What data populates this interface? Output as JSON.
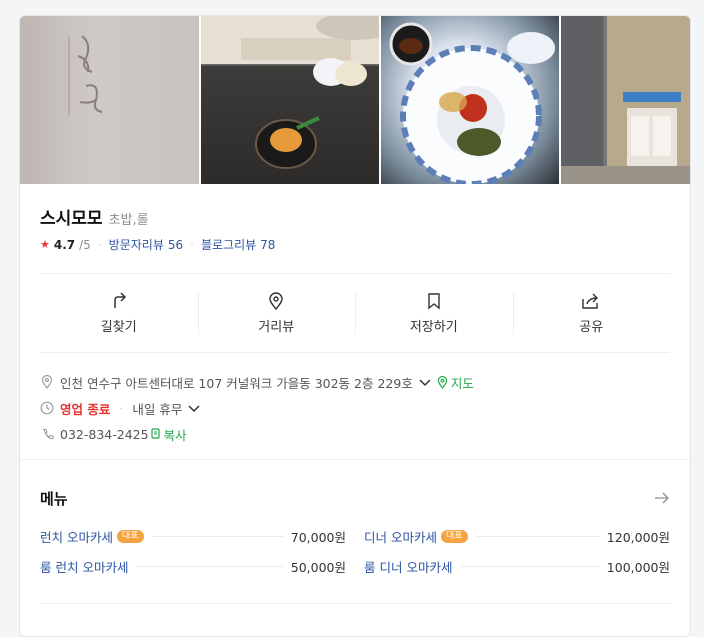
{
  "place": {
    "name": "스시모모",
    "category": "초밥,롤",
    "rating": "4.7",
    "rating_max": "/5",
    "visitor_reviews_label": "방문자리뷰",
    "visitor_reviews_count": "56",
    "blog_reviews_label": "블로그리뷰",
    "blog_reviews_count": "78"
  },
  "photos": [
    {
      "alt": "store-sign"
    },
    {
      "alt": "uni-dish"
    },
    {
      "alt": "flower-plate-dish"
    },
    {
      "alt": "mall-entrance"
    }
  ],
  "actions": [
    {
      "label": "길찾기",
      "icon": "directions-icon"
    },
    {
      "label": "거리뷰",
      "icon": "location-pin-icon"
    },
    {
      "label": "저장하기",
      "icon": "bookmark-icon"
    },
    {
      "label": "공유",
      "icon": "share-icon"
    }
  ],
  "info": {
    "address": "인천 연수구 아트센터대로 107 커널워크 가을동 302동 2층 229호",
    "map_label": "지도",
    "status": "영업 종료",
    "next": "내일 휴무",
    "phone": "032-834-2425",
    "copy_label": "복사"
  },
  "menu": {
    "title": "메뉴",
    "items": [
      {
        "name": "런치 오마카세",
        "badge": "대표",
        "price": "70,000원"
      },
      {
        "name": "디너 오마카세",
        "badge": "대표",
        "price": "120,000원"
      },
      {
        "name": "룸 런치 오마카세",
        "badge": "",
        "price": "50,000원"
      },
      {
        "name": "룸 디너 오마카세",
        "badge": "",
        "price": "100,000원"
      }
    ]
  },
  "colors": {
    "link": "#2b53a3",
    "closed": "#e3342f",
    "green": "#1fa64a",
    "badge": "#f4a340"
  }
}
